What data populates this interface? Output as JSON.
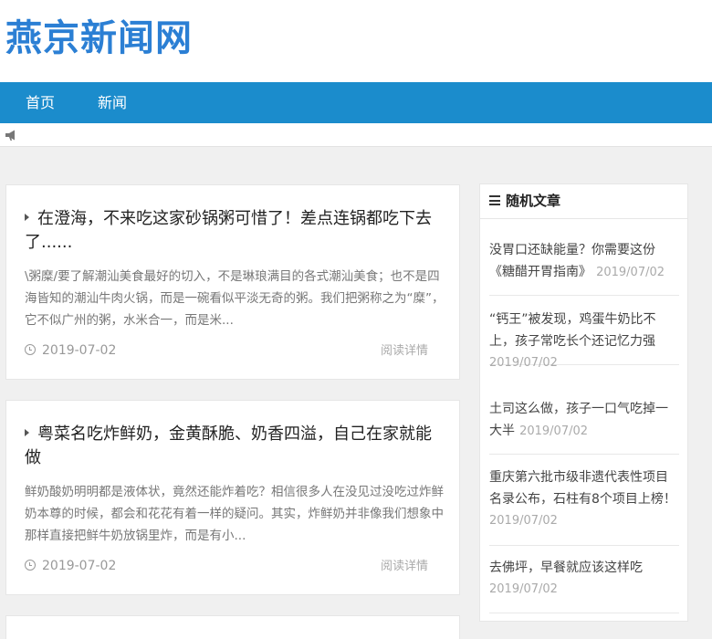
{
  "site": {
    "title": "燕京新闻网"
  },
  "nav": {
    "items": [
      {
        "label": "首页"
      },
      {
        "label": "新闻"
      }
    ]
  },
  "posts": [
    {
      "title": "在澄海，不来吃这家砂锅粥可惜了！差点连锅都吃下去了......",
      "excerpt": "\\粥糜/要了解潮汕美食最好的切入，不是琳琅满目的各式潮汕美食；也不是四海皆知的潮汕牛肉火锅，而是一碗看似平淡无奇的粥。我们把粥称之为“糜”，它不似广州的粥，水米合一，而是米...",
      "date": "2019-07-02",
      "read_more": "阅读详情"
    },
    {
      "title": "粤菜名吃炸鲜奶，金黄酥脆、奶香四溢，自己在家就能做",
      "excerpt": "鲜奶酸奶明明都是液体状，竟然还能炸着吃？相信很多人在没见过没吃过炸鲜奶本尊的时候，都会和花花有着一样的疑问。其实，炸鲜奶并非像我们想象中那样直接把鲜牛奶放锅里炸，而是有小...",
      "date": "2019-07-02",
      "read_more": "阅读详情"
    }
  ],
  "sidebar": {
    "title": "随机文章",
    "items": [
      {
        "title": "没胃口还缺能量？你需要这份《糖醋开胃指南》",
        "date": "2019/07/02"
      },
      {
        "title": "“钙王”被发现，鸡蛋牛奶比不上，孩子常吃长个还记忆力强",
        "date": "2019/07/02"
      },
      {
        "title": "土司这么做，孩子一口气吃掉一大半",
        "date": "2019/07/02"
      },
      {
        "title": "重庆第六批市级非遗代表性项目名录公布，石柱有8个项目上榜！",
        "date": "2019/07/02"
      },
      {
        "title": "去佛坪，早餐就应该这样吃",
        "date": "2019/07/02"
      }
    ]
  },
  "colors": {
    "brand": "#2b7fd4",
    "nav_bg": "#1b8ccc",
    "page_bg": "#f0f0f0"
  }
}
